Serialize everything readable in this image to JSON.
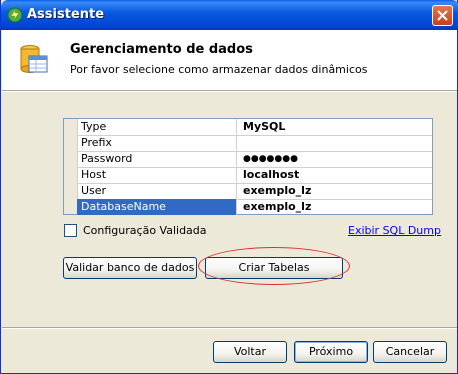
{
  "window": {
    "title": "Assistente"
  },
  "header": {
    "title": "Gerenciamento de dados",
    "subtitle": "Por favor selecione como armazenar dados dinâmicos"
  },
  "properties": [
    {
      "name": "Type",
      "value": "MySQL"
    },
    {
      "name": "Prefix",
      "value": ""
    },
    {
      "name": "Password",
      "value": "●●●●●●●"
    },
    {
      "name": "Host",
      "value": "localhost"
    },
    {
      "name": "User",
      "value": "exemplo_lz"
    },
    {
      "name": "DatabaseName",
      "value": "exemplo_lz",
      "selected": true
    }
  ],
  "options": {
    "validated_label": "Configuração Validada",
    "validated_checked": false,
    "sql_dump_link": "Exibir SQL Dump"
  },
  "actions": {
    "validate_label": "Validar banco de dados",
    "create_tables_label": "Criar Tabelas"
  },
  "footer": {
    "back_label": "Voltar",
    "next_label": "Próximo",
    "cancel_label": "Cancelar"
  },
  "colors": {
    "titlebar": "#0046d5",
    "selection": "#316ac5",
    "link": "#0000ff",
    "highlight_ellipse": "#e03030"
  },
  "icons": {
    "title": "wizard-lightning-icon",
    "header": "database-table-icon",
    "close": "close-icon"
  }
}
